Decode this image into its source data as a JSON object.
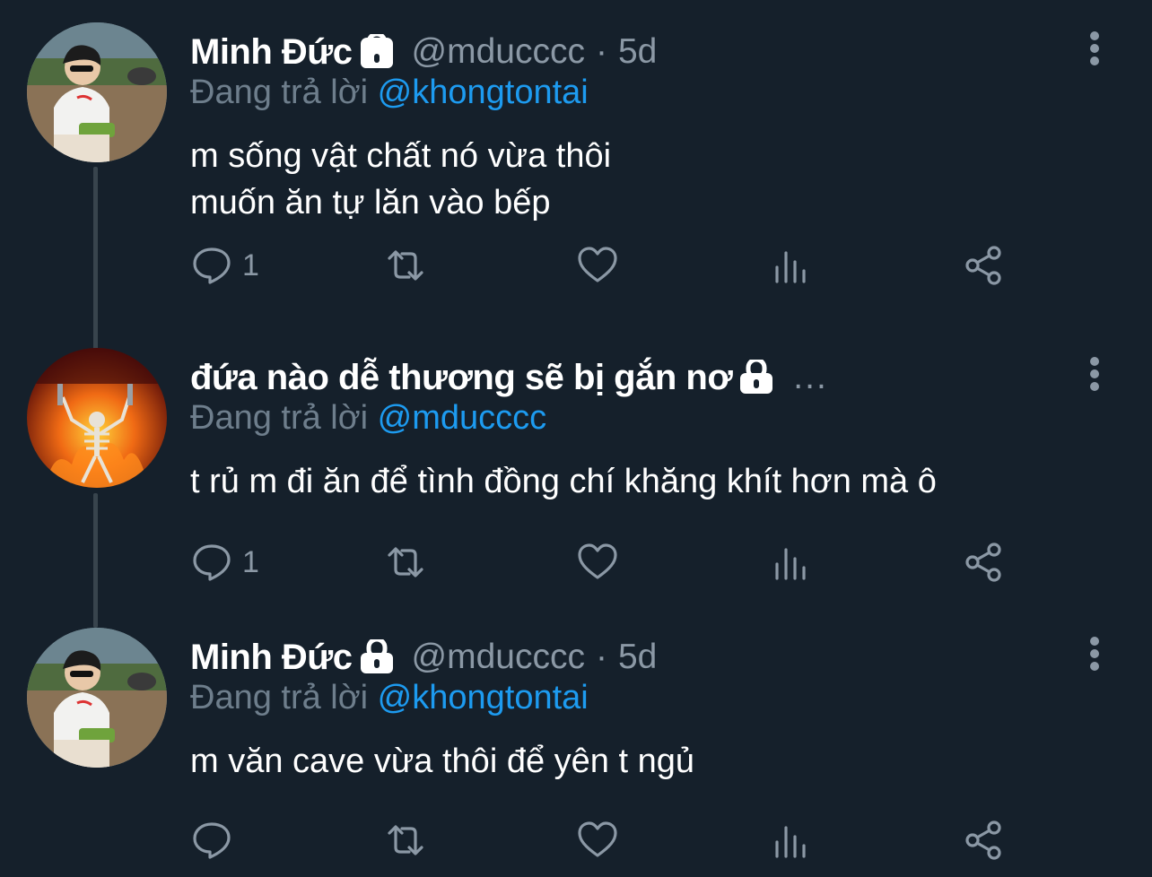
{
  "colors": {
    "background": "#15202b",
    "thread_line": "#38444d",
    "text_primary": "#ffffff",
    "text_secondary": "#8b98a5",
    "mention": "#1d9bf0"
  },
  "tweets": [
    {
      "display_name": "Minh Đức",
      "protected_icon": "lock-icon",
      "handle": "@mducccc",
      "separator": "·",
      "time": "5d",
      "reply_prefix": "Đang trả lời",
      "reply_to": "@khongtontai",
      "text_lines": [
        "m sống vật chất nó vừa thôi",
        "muốn ăn tự lăn vào bếp"
      ],
      "reply_count": "1",
      "avatar": "avatar-boy-outdoor"
    },
    {
      "display_name": "đứa nào dễ thương sẽ bị gắn nơ",
      "protected_icon": "lock-icon",
      "truncation": "...",
      "reply_prefix": "Đang trả lời",
      "reply_to": "@mducccc",
      "text_lines": [
        "t rủ m đi ăn để tình đồng chí khăng khít hơn mà ô"
      ],
      "reply_count": "1",
      "avatar": "avatar-skeleton-fire"
    },
    {
      "display_name": "Minh Đức",
      "protected_icon": "lock-icon",
      "handle": "@mducccc",
      "separator": "·",
      "time": "5d",
      "reply_prefix": "Đang trả lời",
      "reply_to": "@khongtontai",
      "text_lines": [
        "m văn cave vừa thôi để yên t ngủ"
      ],
      "reply_count": "",
      "avatar": "avatar-boy-outdoor"
    }
  ],
  "action_icons": [
    "reply-icon",
    "retweet-icon",
    "like-icon",
    "views-icon",
    "share-icon"
  ]
}
